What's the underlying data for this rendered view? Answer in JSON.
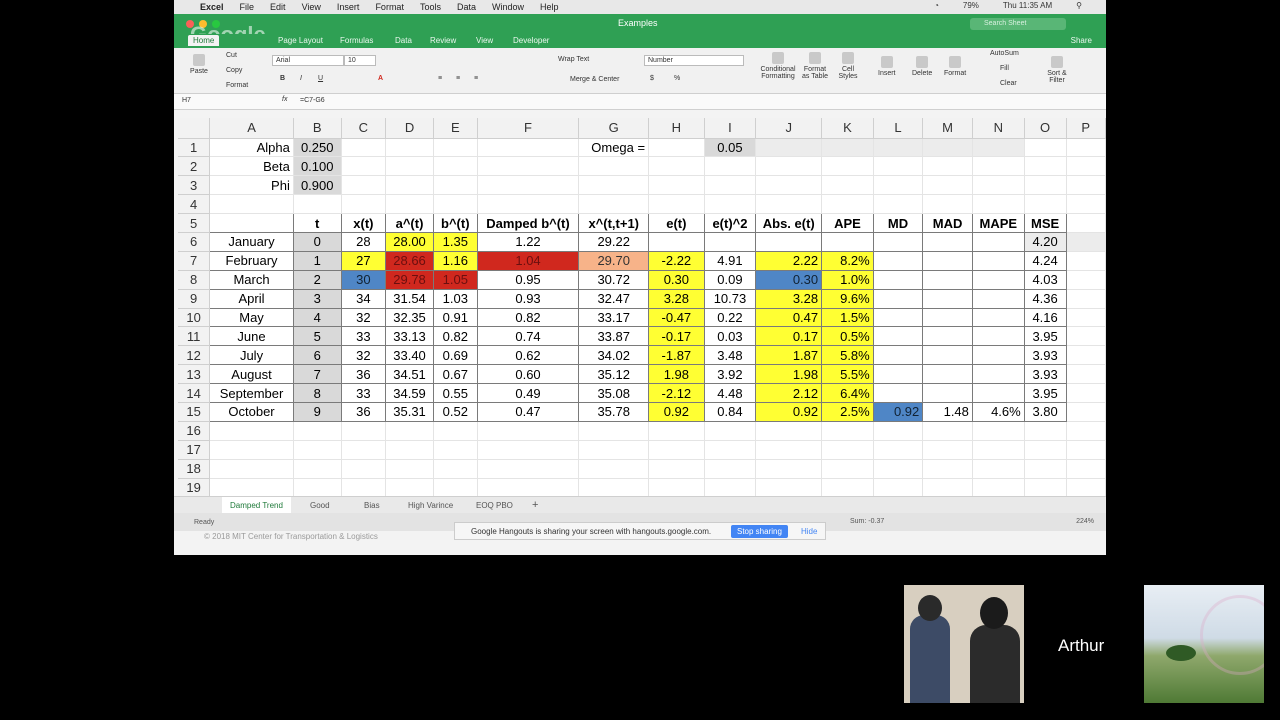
{
  "menubar": {
    "app": "Excel",
    "items": [
      "File",
      "Edit",
      "View",
      "Insert",
      "Format",
      "Tools",
      "Data",
      "Window",
      "Help"
    ],
    "battery": "79%",
    "clock": "Thu 11:35 AM"
  },
  "titlebar": {
    "doc_title": "Examples",
    "search_placeholder": "Search Sheet"
  },
  "ribbon_tabs": {
    "items": [
      "Home",
      "Page Layout",
      "Formulas",
      "Data",
      "Review",
      "View",
      "Developer"
    ],
    "share": "Share"
  },
  "ribbon": {
    "paste": "Paste",
    "cut": "Cut",
    "copy": "Copy",
    "format_painter": "Format",
    "font_name": "Arial",
    "font_size": "10",
    "wrap_text": "Wrap Text",
    "merge_center": "Merge & Center",
    "number_format": "Number",
    "conditional": "Conditional Formatting",
    "format_table": "Format as Table",
    "cell_styles": "Cell Styles",
    "insert": "Insert",
    "delete": "Delete",
    "format": "Format",
    "autosum": "AutoSum",
    "fill": "Fill",
    "clear": "Clear",
    "sort_filter": "Sort & Filter"
  },
  "formula_bar": {
    "cell_ref": "H7",
    "fx": "fx",
    "formula": "=C7-G6"
  },
  "columns": [
    "A",
    "B",
    "C",
    "D",
    "E",
    "F",
    "G",
    "H",
    "I",
    "J",
    "K",
    "L",
    "M",
    "N",
    "O",
    "P"
  ],
  "rows": {
    "r1": {
      "a": "Alpha",
      "b": "0.250",
      "g": "Omega =",
      "i": "0.05"
    },
    "r2": {
      "a": "Beta",
      "b": "0.100"
    },
    "r3": {
      "a": "Phi",
      "b": "0.900"
    },
    "header": [
      "t",
      "x(t)",
      "a^(t)",
      "b^(t)",
      "Damped b^(t)",
      "x^(t,t+1)",
      "e(t)",
      "e(t)^2",
      "Abs. e(t)",
      "APE",
      "MD",
      "MAD",
      "MAPE",
      "MSE"
    ],
    "data": [
      {
        "month": "January",
        "t": "0",
        "x": "28",
        "a": "28.00",
        "b": "1.35",
        "db": "1.22",
        "f": "29.22",
        "e": "",
        "e2": "",
        "abs": "",
        "ape": "",
        "md": "",
        "mad": "",
        "mape": "",
        "mse": "4.20"
      },
      {
        "month": "February",
        "t": "1",
        "x": "27",
        "a": "28.66",
        "b": "1.16",
        "db": "1.04",
        "f": "29.70",
        "e": "-2.22",
        "e2": "4.91",
        "abs": "2.22",
        "ape": "8.2%",
        "md": "",
        "mad": "",
        "mape": "",
        "mse": "4.24"
      },
      {
        "month": "March",
        "t": "2",
        "x": "30",
        "a": "29.78",
        "b": "1.05",
        "db": "0.95",
        "f": "30.72",
        "e": "0.30",
        "e2": "0.09",
        "abs": "0.30",
        "ape": "1.0%",
        "md": "",
        "mad": "",
        "mape": "",
        "mse": "4.03"
      },
      {
        "month": "April",
        "t": "3",
        "x": "34",
        "a": "31.54",
        "b": "1.03",
        "db": "0.93",
        "f": "32.47",
        "e": "3.28",
        "e2": "10.73",
        "abs": "3.28",
        "ape": "9.6%",
        "md": "",
        "mad": "",
        "mape": "",
        "mse": "4.36"
      },
      {
        "month": "May",
        "t": "4",
        "x": "32",
        "a": "32.35",
        "b": "0.91",
        "db": "0.82",
        "f": "33.17",
        "e": "-0.47",
        "e2": "0.22",
        "abs": "0.47",
        "ape": "1.5%",
        "md": "",
        "mad": "",
        "mape": "",
        "mse": "4.16"
      },
      {
        "month": "June",
        "t": "5",
        "x": "33",
        "a": "33.13",
        "b": "0.82",
        "db": "0.74",
        "f": "33.87",
        "e": "-0.17",
        "e2": "0.03",
        "abs": "0.17",
        "ape": "0.5%",
        "md": "",
        "mad": "",
        "mape": "",
        "mse": "3.95"
      },
      {
        "month": "July",
        "t": "6",
        "x": "32",
        "a": "33.40",
        "b": "0.69",
        "db": "0.62",
        "f": "34.02",
        "e": "-1.87",
        "e2": "3.48",
        "abs": "1.87",
        "ape": "5.8%",
        "md": "",
        "mad": "",
        "mape": "",
        "mse": "3.93"
      },
      {
        "month": "August",
        "t": "7",
        "x": "36",
        "a": "34.51",
        "b": "0.67",
        "db": "0.60",
        "f": "35.12",
        "e": "1.98",
        "e2": "3.92",
        "abs": "1.98",
        "ape": "5.5%",
        "md": "",
        "mad": "",
        "mape": "",
        "mse": "3.93"
      },
      {
        "month": "September",
        "t": "8",
        "x": "33",
        "a": "34.59",
        "b": "0.55",
        "db": "0.49",
        "f": "35.08",
        "e": "-2.12",
        "e2": "4.48",
        "abs": "2.12",
        "ape": "6.4%",
        "md": "",
        "mad": "",
        "mape": "",
        "mse": "3.95"
      },
      {
        "month": "October",
        "t": "9",
        "x": "36",
        "a": "35.31",
        "b": "0.52",
        "db": "0.47",
        "f": "35.78",
        "e": "0.92",
        "e2": "0.84",
        "abs": "0.92",
        "ape": "2.5%",
        "md": "0.92",
        "mad": "1.48",
        "mape": "4.6%",
        "mse": "3.80"
      }
    ]
  },
  "sheet_tabs": [
    "Damped Trend",
    "Good",
    "Bias",
    "High Varince",
    "EOQ PBO"
  ],
  "status": {
    "ready": "Ready",
    "sum": "Sum: -0.37",
    "zoom": "224%"
  },
  "hangouts": {
    "message": "Google Hangouts is sharing your screen with hangouts.google.com.",
    "stop": "Stop sharing",
    "hide": "Hide"
  },
  "watermark": "© 2018 MIT Center for Transportation & Logistics",
  "overlay_logo": "Google",
  "participant": "Arthur",
  "colors": {
    "excel_green": "#2fa054",
    "highlight_yellow": "#ffff33",
    "highlight_red": "#d0281e",
    "highlight_blue": "#4f86c6",
    "highlight_orange": "#f7b389",
    "highlight_green": "#9bc55a"
  }
}
